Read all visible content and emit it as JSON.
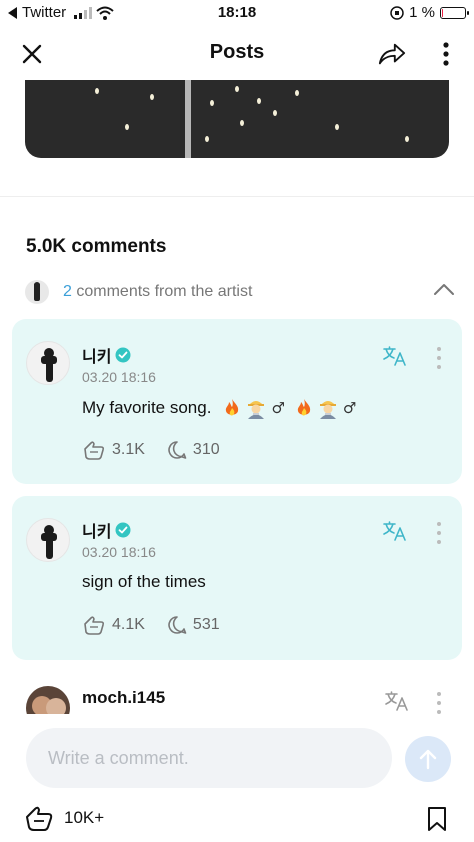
{
  "status_bar": {
    "carrier": "Twitter",
    "time": "18:18",
    "battery_percent": "1 %",
    "battery_level": 0.01
  },
  "header": {
    "title": "Posts"
  },
  "comments_summary": {
    "count_label": "5.0K comments"
  },
  "artist_comments": {
    "count": "2",
    "label": "comments from the artist"
  },
  "comments": [
    {
      "author": "니키",
      "verified": true,
      "date": "03.20 18:16",
      "text": "My favorite song.",
      "emoji": [
        "fire",
        "man-factory-worker",
        "male-sign",
        "fire",
        "man-factory-worker",
        "male-sign"
      ],
      "likes": "3.1K",
      "replies": "310"
    },
    {
      "author": "니키",
      "verified": true,
      "date": "03.20 18:16",
      "text": "sign of the times",
      "likes": "4.1K",
      "replies": "531"
    },
    {
      "author": "moch.i145"
    }
  ],
  "composer": {
    "placeholder": "Write a comment.",
    "post_likes": "10K+"
  },
  "colors": {
    "card_background": "#e6f8f7",
    "accent_blue": "#3b9fd8",
    "verified_teal": "#33c5c2",
    "send_button": "#dbe8f8"
  }
}
